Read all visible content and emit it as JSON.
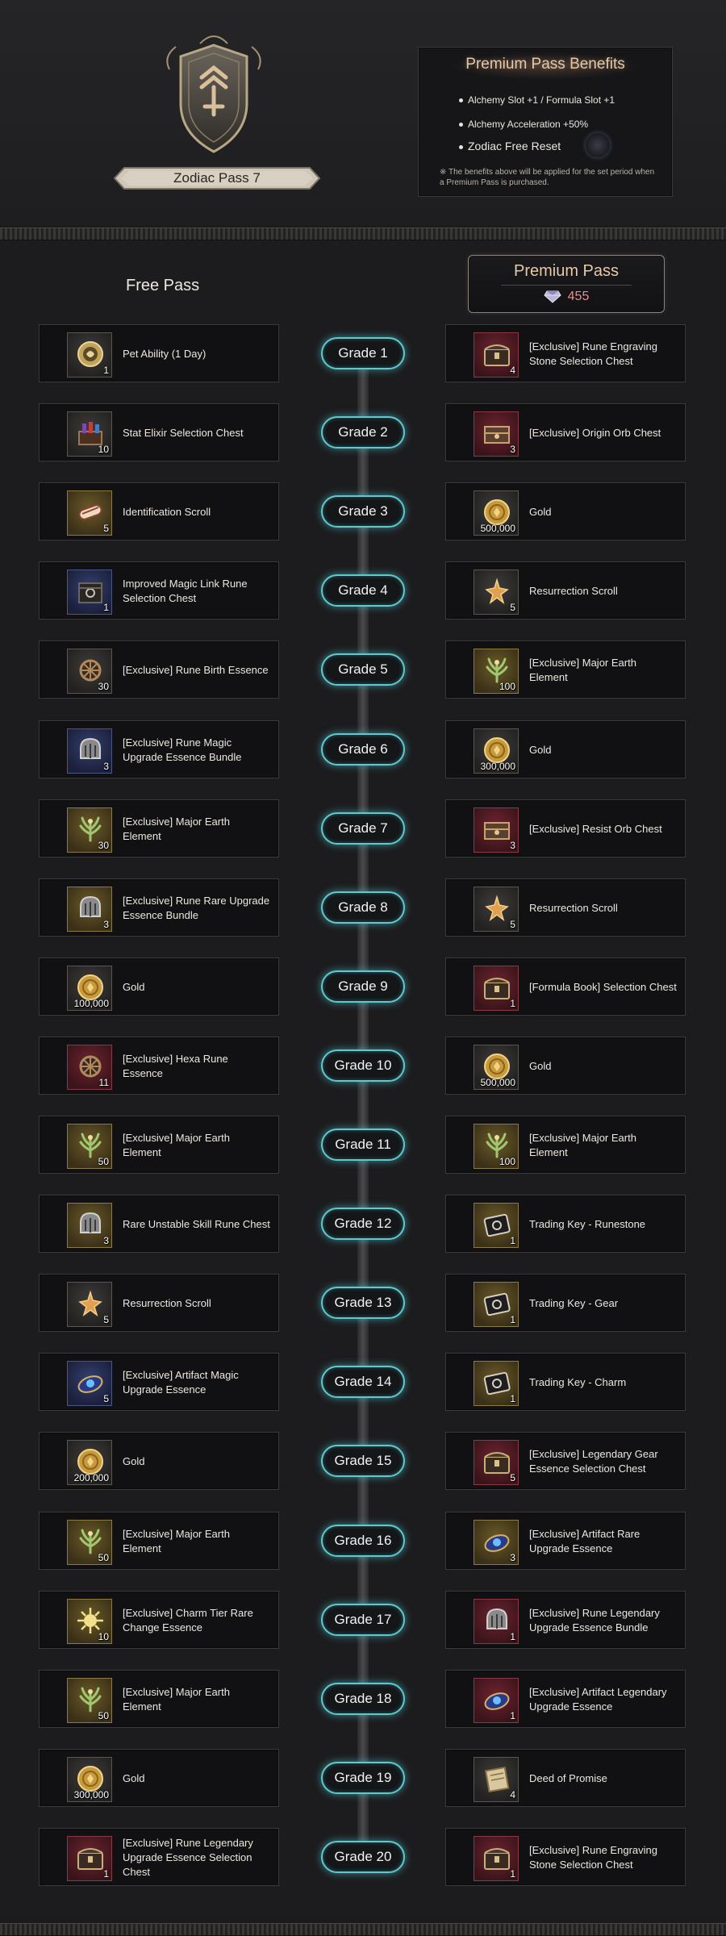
{
  "pass_title": "Zodiac Pass 7",
  "benefits": {
    "title": "Premium Pass Benefits",
    "items": [
      "Alchemy Slot +1 / Formula Slot +1",
      "Alchemy Acceleration +50%",
      "Zodiac Free Reset"
    ],
    "note": "※ The benefits above will be applied for the set period when a Premium Pass is purchased."
  },
  "free_pass_label": "Free Pass",
  "premium_pass": {
    "label": "Premium Pass",
    "price": "455",
    "price_color": "#f08a8a"
  },
  "accent_colors": {
    "grade_glow": "#5fc9d0",
    "gold_text": "#e6c9a8"
  },
  "rows": [
    {
      "grade": "Grade 1",
      "free": {
        "name": "Pet Ability (1 Day)",
        "qty": "1",
        "icon": "pet-ability-icon",
        "frame": "gray"
      },
      "prem": {
        "name": "[Exclusive] Rune Engraving Stone Selection Chest",
        "qty": "4",
        "icon": "chest-icon",
        "frame": "red"
      }
    },
    {
      "grade": "Grade 2",
      "free": {
        "name": "Stat Elixir Selection Chest",
        "qty": "10",
        "icon": "elixir-chest-icon",
        "frame": "gray"
      },
      "prem": {
        "name": "[Exclusive] Origin Orb Chest",
        "qty": "3",
        "icon": "orb-chest-icon",
        "frame": "red"
      }
    },
    {
      "grade": "Grade 3",
      "free": {
        "name": "Identification Scroll",
        "qty": "5",
        "icon": "scroll-icon",
        "frame": "yellow"
      },
      "prem": {
        "name": "Gold",
        "qty": "500,000",
        "icon": "gold-coin-icon",
        "frame": "gray"
      }
    },
    {
      "grade": "Grade 4",
      "free": {
        "name": "Improved Magic Link Rune Selection Chest",
        "qty": "1",
        "icon": "rune-chest-icon",
        "frame": "blue"
      },
      "prem": {
        "name": "Resurrection Scroll",
        "qty": "5",
        "icon": "resurrection-scroll-icon",
        "frame": "gray"
      }
    },
    {
      "grade": "Grade 5",
      "free": {
        "name": "[Exclusive] Rune Birth Essence",
        "qty": "30",
        "icon": "essence-icon",
        "frame": "gray"
      },
      "prem": {
        "name": "[Exclusive] Major Earth Element",
        "qty": "100",
        "icon": "earth-element-icon",
        "frame": "yellow"
      }
    },
    {
      "grade": "Grade 6",
      "free": {
        "name": "[Exclusive] Rune Magic Upgrade Essence Bundle",
        "qty": "3",
        "icon": "helmet-bundle-icon",
        "frame": "blue"
      },
      "prem": {
        "name": "Gold",
        "qty": "300,000",
        "icon": "gold-coin-icon",
        "frame": "gray"
      }
    },
    {
      "grade": "Grade 7",
      "free": {
        "name": "[Exclusive] Major Earth Element",
        "qty": "30",
        "icon": "earth-element-icon",
        "frame": "yellow"
      },
      "prem": {
        "name": "[Exclusive] Resist Orb Chest",
        "qty": "3",
        "icon": "orb-chest-icon",
        "frame": "red"
      }
    },
    {
      "grade": "Grade 8",
      "free": {
        "name": "[Exclusive] Rune Rare Upgrade Essence Bundle",
        "qty": "3",
        "icon": "helmet-bundle-icon",
        "frame": "yellow"
      },
      "prem": {
        "name": "Resurrection Scroll",
        "qty": "5",
        "icon": "resurrection-scroll-icon",
        "frame": "gray"
      }
    },
    {
      "grade": "Grade 9",
      "free": {
        "name": "Gold",
        "qty": "100,000",
        "icon": "gold-coin-icon",
        "frame": "gray"
      },
      "prem": {
        "name": "[Formula Book] Selection Chest",
        "qty": "1",
        "icon": "chest-icon",
        "frame": "red"
      }
    },
    {
      "grade": "Grade 10",
      "free": {
        "name": "[Exclusive] Hexa Rune Essence",
        "qty": "11",
        "icon": "essence-icon",
        "frame": "red"
      },
      "prem": {
        "name": "Gold",
        "qty": "500,000",
        "icon": "gold-coin-icon",
        "frame": "gray"
      }
    },
    {
      "grade": "Grade 11",
      "free": {
        "name": "[Exclusive] Major Earth Element",
        "qty": "50",
        "icon": "earth-element-icon",
        "frame": "yellow"
      },
      "prem": {
        "name": "[Exclusive] Major Earth Element",
        "qty": "100",
        "icon": "earth-element-icon",
        "frame": "yellow"
      }
    },
    {
      "grade": "Grade 12",
      "free": {
        "name": "Rare Unstable Skill Rune Chest",
        "qty": "3",
        "icon": "helmet-bundle-icon",
        "frame": "yellow"
      },
      "prem": {
        "name": "Trading Key - Runestone",
        "qty": "1",
        "icon": "trading-key-icon",
        "frame": "yellow"
      }
    },
    {
      "grade": "Grade 13",
      "free": {
        "name": "Resurrection Scroll",
        "qty": "5",
        "icon": "resurrection-scroll-icon",
        "frame": "gray"
      },
      "prem": {
        "name": "Trading Key - Gear",
        "qty": "1",
        "icon": "trading-key-icon",
        "frame": "yellow"
      }
    },
    {
      "grade": "Grade 14",
      "free": {
        "name": "[Exclusive] Artifact Magic Upgrade Essence",
        "qty": "5",
        "icon": "artifact-essence-icon",
        "frame": "blue"
      },
      "prem": {
        "name": "Trading Key - Charm",
        "qty": "1",
        "icon": "trading-key-icon",
        "frame": "yellow"
      }
    },
    {
      "grade": "Grade 15",
      "free": {
        "name": "Gold",
        "qty": "200,000",
        "icon": "gold-coin-icon",
        "frame": "gray"
      },
      "prem": {
        "name": "[Exclusive] Legendary Gear Essence Selection Chest",
        "qty": "5",
        "icon": "chest-icon",
        "frame": "red"
      }
    },
    {
      "grade": "Grade 16",
      "free": {
        "name": "[Exclusive] Major Earth Element",
        "qty": "50",
        "icon": "earth-element-icon",
        "frame": "yellow"
      },
      "prem": {
        "name": "[Exclusive] Artifact Rare Upgrade Essence",
        "qty": "3",
        "icon": "artifact-essence-icon",
        "frame": "yellow"
      }
    },
    {
      "grade": "Grade 17",
      "free": {
        "name": "[Exclusive] Charm Tier Rare Change Essence",
        "qty": "10",
        "icon": "charm-essence-icon",
        "frame": "yellow"
      },
      "prem": {
        "name": "[Exclusive] Rune Legendary Upgrade Essence Bundle",
        "qty": "1",
        "icon": "helmet-bundle-icon",
        "frame": "red"
      }
    },
    {
      "grade": "Grade 18",
      "free": {
        "name": "[Exclusive] Major Earth Element",
        "qty": "50",
        "icon": "earth-element-icon",
        "frame": "yellow"
      },
      "prem": {
        "name": "[Exclusive] Artifact Legendary Upgrade Essence",
        "qty": "1",
        "icon": "artifact-essence-icon",
        "frame": "red"
      }
    },
    {
      "grade": "Grade 19",
      "free": {
        "name": "Gold",
        "qty": "300,000",
        "icon": "gold-coin-icon",
        "frame": "gray"
      },
      "prem": {
        "name": "Deed of Promise",
        "qty": "4",
        "icon": "deed-icon",
        "frame": "gray"
      }
    },
    {
      "grade": "Grade 20",
      "free": {
        "name": "[Exclusive] Rune Legendary Upgrade Essence Selection Chest",
        "qty": "1",
        "icon": "chest-icon",
        "frame": "red"
      },
      "prem": {
        "name": "[Exclusive] Rune Engraving Stone Selection Chest",
        "qty": "1",
        "icon": "chest-icon",
        "frame": "red"
      }
    }
  ]
}
